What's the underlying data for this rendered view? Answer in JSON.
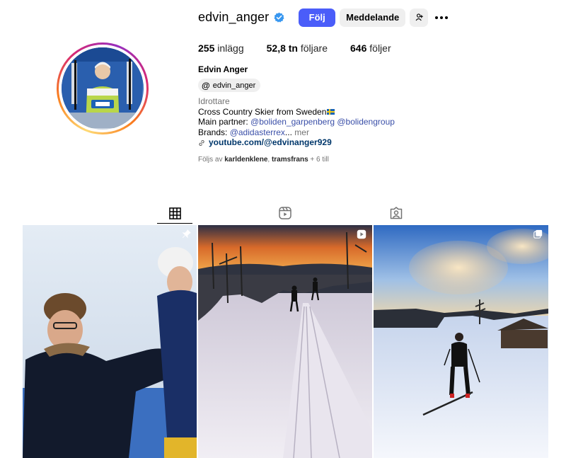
{
  "profile": {
    "username": "edvin_anger",
    "full_name": "Edvin Anger",
    "threads_handle": "edvin_anger",
    "verified_icon": "verified-badge-icon",
    "accent_color": "#4a5df9"
  },
  "actions": {
    "follow_label": "Följ",
    "message_label": "Meddelande"
  },
  "stats": [
    {
      "value": "255",
      "label": "inlägg"
    },
    {
      "value": "52,8 tn",
      "label": "följare"
    },
    {
      "value": "646",
      "label": "följer"
    }
  ],
  "bio": {
    "category": "Idrottare",
    "line1": "Cross Country Skier from Sweden",
    "partner_prefix": "Main partner: ",
    "partner_mention_1": "@boliden_garpenberg",
    "partner_mention_2": "@bolidengroup",
    "brands_prefix": "Brands: ",
    "brands_mention": "@adidasterrex",
    "brands_ellipsis": "...",
    "more": " mer",
    "link": "youtube.com/@edvinanger929"
  },
  "followed_by": {
    "prefix": "Följs av ",
    "user1": "karldenklene",
    "sep": ", ",
    "user2": "tramsfrans",
    "suffix": " + 6 till"
  },
  "tabs": [
    {
      "icon": "grid-icon",
      "active": true
    },
    {
      "icon": "reels-icon",
      "active": false
    },
    {
      "icon": "tagged-icon",
      "active": false
    }
  ],
  "posts": [
    {
      "subject": "king-and-skier",
      "badge": "pin-icon"
    },
    {
      "subject": "sunset-ski-track",
      "badge": "reel-icon"
    },
    {
      "subject": "winter-skier-sunset",
      "badge": "carousel-icon"
    }
  ]
}
